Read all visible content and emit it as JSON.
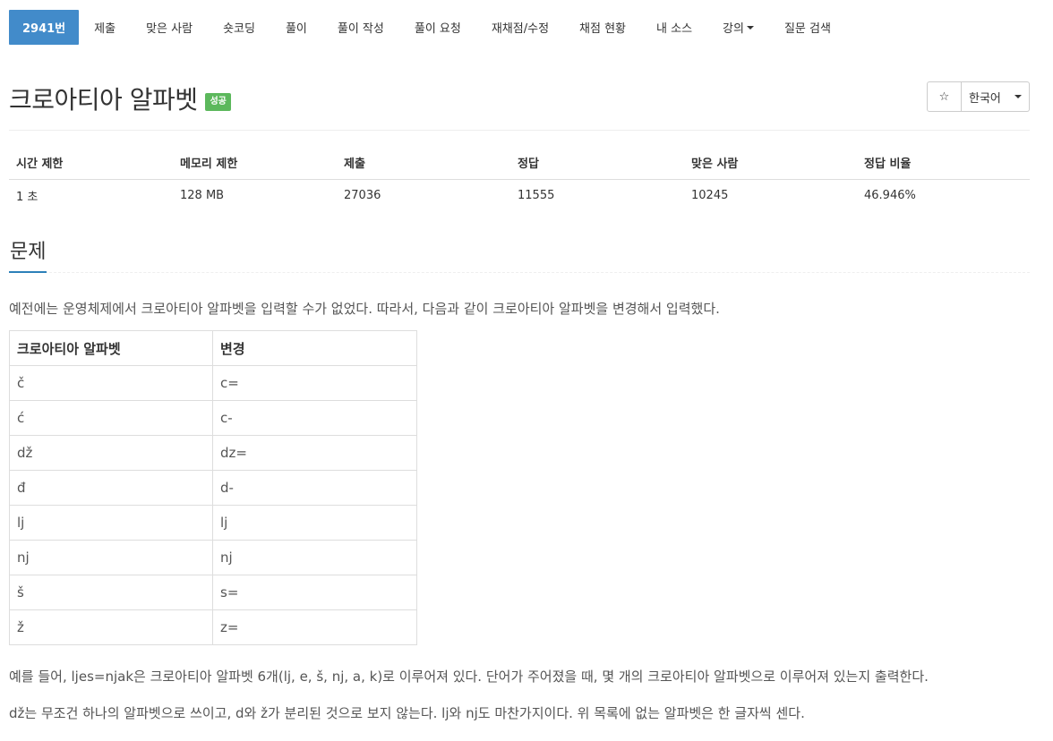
{
  "nav": {
    "items": [
      {
        "label": "2941번",
        "active": true
      },
      {
        "label": "제출"
      },
      {
        "label": "맞은 사람"
      },
      {
        "label": "숏코딩"
      },
      {
        "label": "풀이"
      },
      {
        "label": "풀이 작성"
      },
      {
        "label": "풀이 요청"
      },
      {
        "label": "재채점/수정"
      },
      {
        "label": "채점 현황"
      },
      {
        "label": "내 소스"
      },
      {
        "label": "강의",
        "dropdown": true
      },
      {
        "label": "질문 검색"
      }
    ]
  },
  "problem": {
    "title": "크로아티아 알파벳",
    "badge": "성공",
    "badge_color": "#5cb85c",
    "star_icon": "☆",
    "language": "한국어"
  },
  "stats": {
    "headers": [
      "시간 제한",
      "메모리 제한",
      "제출",
      "정답",
      "맞은 사람",
      "정답 비율"
    ],
    "values": [
      "1 초",
      "128 MB",
      "27036",
      "11555",
      "10245",
      "46.946%"
    ]
  },
  "section": {
    "title": "문제",
    "intro": "예전에는 운영체제에서 크로아티아 알파벳을 입력할 수가 없었다. 따라서, 다음과 같이 크로아티아 알파벳을 변경해서 입력했다.",
    "table_headers": [
      "크로아티아 알파벳",
      "변경"
    ],
    "table_rows": [
      [
        "č",
        "c="
      ],
      [
        "ć",
        "c-"
      ],
      [
        "dž",
        "dz="
      ],
      [
        "đ",
        "d-"
      ],
      [
        "lj",
        "lj"
      ],
      [
        "nj",
        "nj"
      ],
      [
        "š",
        "s="
      ],
      [
        "ž",
        "z="
      ]
    ],
    "para2": "예를 들어, ljes=njak은 크로아티아 알파벳 6개(lj, e, š, nj, a, k)로 이루어져 있다. 단어가 주어졌을 때, 몇 개의 크로아티아 알파벳으로 이루어져 있는지 출력한다.",
    "para3": "dž는 무조건 하나의 알파벳으로 쓰이고, d와 ž가 분리된 것으로 보지 않는다. lj와 nj도 마찬가지이다. 위 목록에 없는 알파벳은 한 글자씩 센다."
  },
  "colors": {
    "accent": "#428bca",
    "success": "#5cb85c",
    "section_underline": "#2c80b9"
  }
}
